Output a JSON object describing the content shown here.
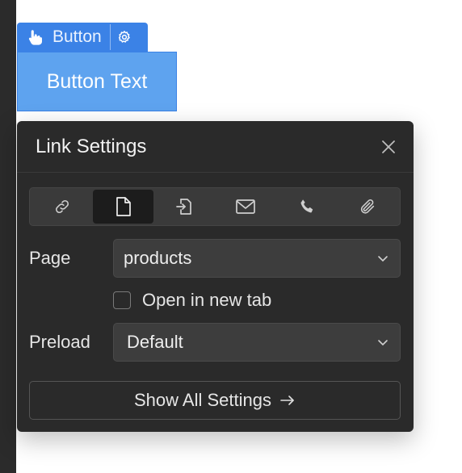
{
  "element_badge": {
    "label": "Button",
    "hand_icon": "hand-pointer-icon",
    "settings_icon": "gear-icon"
  },
  "canvas_button": {
    "text": "Button Text"
  },
  "panel": {
    "title": "Link Settings",
    "tabs": [
      {
        "icon": "url-link-icon",
        "active": false
      },
      {
        "icon": "page-icon",
        "active": true
      },
      {
        "icon": "page-section-icon",
        "active": false
      },
      {
        "icon": "email-icon",
        "active": false
      },
      {
        "icon": "phone-icon",
        "active": false
      },
      {
        "icon": "attachment-icon",
        "active": false
      }
    ],
    "page_label": "Page",
    "page_value": "products",
    "open_new_tab_label": "Open in new tab",
    "open_new_tab_checked": false,
    "preload_label": "Preload",
    "preload_value": "Default",
    "show_all_label": "Show All Settings"
  },
  "colors": {
    "accent": "#3b82e6",
    "button_fill": "#5ea3ef",
    "panel_bg": "#2a2a2a"
  }
}
